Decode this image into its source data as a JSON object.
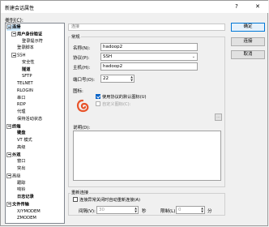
{
  "window": {
    "title": "新建会话属性",
    "help": "?",
    "close": "✕"
  },
  "category_label": "类别(C):",
  "tree": [
    {
      "label": "连接",
      "bold": true,
      "expander": true,
      "indent": 0,
      "selected": true
    },
    {
      "label": "用户身份验证",
      "bold": true,
      "expander": true,
      "indent": 1
    },
    {
      "label": "登录提示符",
      "indent": 2
    },
    {
      "label": "登录脚本",
      "indent": 1
    },
    {
      "label": "SSH",
      "expander": true,
      "indent": 1
    },
    {
      "label": "安全性",
      "indent": 2
    },
    {
      "label": "隧道",
      "bold": true,
      "indent": 2
    },
    {
      "label": "SFTP",
      "indent": 2
    },
    {
      "label": "TELNET",
      "indent": 1
    },
    {
      "label": "RLOGIN",
      "indent": 1
    },
    {
      "label": "串口",
      "indent": 1
    },
    {
      "label": "RDP",
      "indent": 1
    },
    {
      "label": "代理",
      "indent": 1
    },
    {
      "label": "保持活动状态",
      "indent": 1
    },
    {
      "label": "终端",
      "bold": true,
      "expander": true,
      "indent": 0
    },
    {
      "label": "键盘",
      "bold": true,
      "indent": 1
    },
    {
      "label": "VT 模式",
      "indent": 1
    },
    {
      "label": "高级",
      "indent": 1
    },
    {
      "label": "外观",
      "bold": true,
      "expander": true,
      "indent": 0
    },
    {
      "label": "窗口",
      "indent": 1
    },
    {
      "label": "突出",
      "indent": 1
    },
    {
      "label": "高级",
      "expander": true,
      "indent": 0
    },
    {
      "label": "跟踪",
      "indent": 1
    },
    {
      "label": "响铃",
      "indent": 1
    },
    {
      "label": "日志记录",
      "bold": true,
      "indent": 1
    },
    {
      "label": "文件传输",
      "bold": true,
      "expander": true,
      "indent": 0
    },
    {
      "label": "X/YMODEM",
      "indent": 1
    },
    {
      "label": "ZMODEM",
      "indent": 1
    }
  ],
  "breadcrumb": "连接",
  "general": {
    "title": "常规",
    "name_label": "名称(N):",
    "name_value": "hadoop2",
    "protocol_label": "协议(P):",
    "protocol_value": "SSH",
    "host_label": "主机(H):",
    "host_value": "hadoop2",
    "port_label": "端口号(O):",
    "port_value": "22",
    "icon_label": "图标:",
    "default_icon_label": "使用协议的默认图标(U)",
    "custom_icon_label": "自定义图标(C):",
    "browse_label": "...",
    "desc_label": "说明(D):"
  },
  "reconnect": {
    "title": "重新连接",
    "auto_label": "连接异常关闭时自动重新连接(A)",
    "interval_label": "间隔(V):",
    "interval_value": "30",
    "seconds_label": "秒",
    "limit_label": "限制(L):",
    "limit_value": "0",
    "minutes_label": "分"
  },
  "buttons": {
    "ok": "确定",
    "connect": "连接",
    "cancel": "取消"
  },
  "colors": {
    "accent": "#0a64c8",
    "selection": "#cce8ff"
  }
}
